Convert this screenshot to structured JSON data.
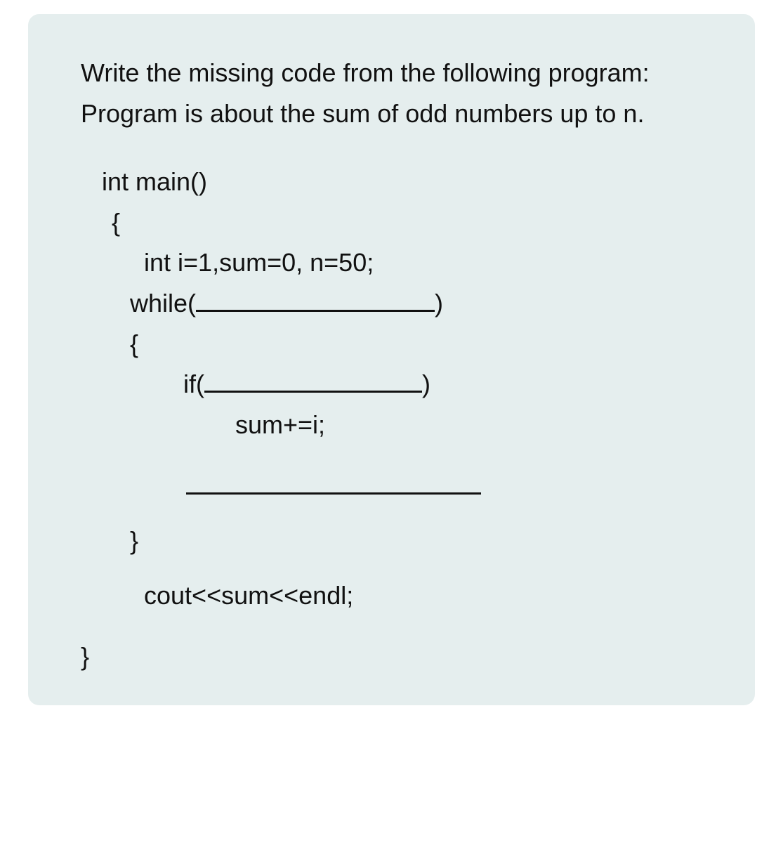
{
  "prompt": {
    "line1": "Write the missing code from the following program:",
    "line2": "Program is about the sum of odd numbers up to n."
  },
  "code": {
    "main_decl": "int main()",
    "open_brace": "{",
    "decl_vars": "int i=1,sum=0, n=50;",
    "while_kw": "while(",
    "while_close": ")",
    "open_brace2": "{",
    "if_kw": "if(",
    "if_close": ")",
    "sum_line": "sum+=i;",
    "close_brace2": "}",
    "cout_line": "cout<<sum<<endl;",
    "close_brace": "}"
  }
}
